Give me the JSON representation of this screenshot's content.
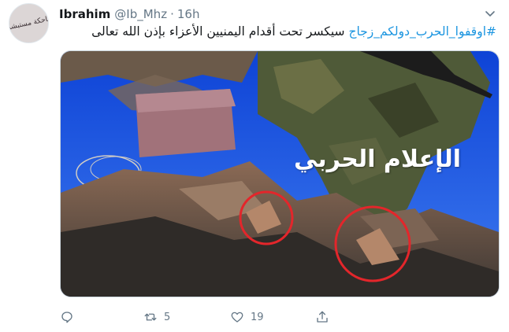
{
  "tweet": {
    "author_name": "Ibrahim",
    "handle": "@Ib_Mhz",
    "separator": "·",
    "time": "16h",
    "hashtag": "#اوقفوا_الحرب_دولكم_زجاج",
    "body": " سيكسر تحت أقدام اليمنيين الأعزاء بإذن الله تعالى",
    "avatar_text": "ضاحكة مستبشرة",
    "media_overlay_text": "الإعلام الحربي",
    "retweet_count": "5",
    "like_count": "19"
  },
  "icons": {
    "more": "chevron-down-icon",
    "reply": "reply-icon",
    "retweet": "retweet-icon",
    "like": "heart-icon",
    "share": "share-icon"
  },
  "colors": {
    "link": "#1b95e0",
    "secondary": "#657786",
    "highlight_circle": "#e3262b"
  }
}
